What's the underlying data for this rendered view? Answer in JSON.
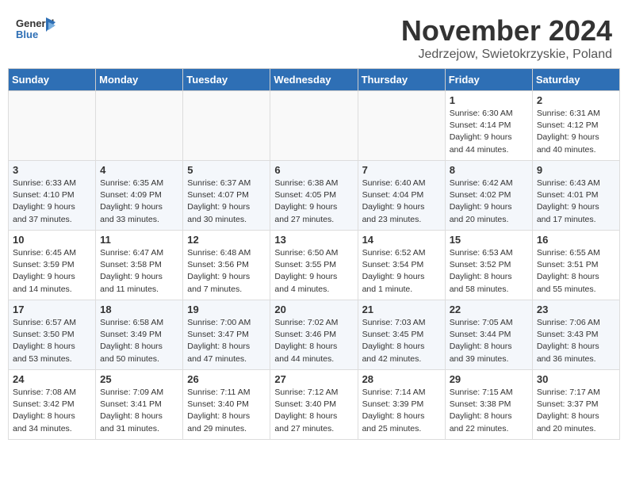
{
  "header": {
    "logo_general": "General",
    "logo_blue": "Blue",
    "month": "November 2024",
    "location": "Jedrzejow, Swietokrzyskie, Poland"
  },
  "weekdays": [
    "Sunday",
    "Monday",
    "Tuesday",
    "Wednesday",
    "Thursday",
    "Friday",
    "Saturday"
  ],
  "weeks": [
    [
      {
        "day": "",
        "info": ""
      },
      {
        "day": "",
        "info": ""
      },
      {
        "day": "",
        "info": ""
      },
      {
        "day": "",
        "info": ""
      },
      {
        "day": "",
        "info": ""
      },
      {
        "day": "1",
        "info": "Sunrise: 6:30 AM\nSunset: 4:14 PM\nDaylight: 9 hours\nand 44 minutes."
      },
      {
        "day": "2",
        "info": "Sunrise: 6:31 AM\nSunset: 4:12 PM\nDaylight: 9 hours\nand 40 minutes."
      }
    ],
    [
      {
        "day": "3",
        "info": "Sunrise: 6:33 AM\nSunset: 4:10 PM\nDaylight: 9 hours\nand 37 minutes."
      },
      {
        "day": "4",
        "info": "Sunrise: 6:35 AM\nSunset: 4:09 PM\nDaylight: 9 hours\nand 33 minutes."
      },
      {
        "day": "5",
        "info": "Sunrise: 6:37 AM\nSunset: 4:07 PM\nDaylight: 9 hours\nand 30 minutes."
      },
      {
        "day": "6",
        "info": "Sunrise: 6:38 AM\nSunset: 4:05 PM\nDaylight: 9 hours\nand 27 minutes."
      },
      {
        "day": "7",
        "info": "Sunrise: 6:40 AM\nSunset: 4:04 PM\nDaylight: 9 hours\nand 23 minutes."
      },
      {
        "day": "8",
        "info": "Sunrise: 6:42 AM\nSunset: 4:02 PM\nDaylight: 9 hours\nand 20 minutes."
      },
      {
        "day": "9",
        "info": "Sunrise: 6:43 AM\nSunset: 4:01 PM\nDaylight: 9 hours\nand 17 minutes."
      }
    ],
    [
      {
        "day": "10",
        "info": "Sunrise: 6:45 AM\nSunset: 3:59 PM\nDaylight: 9 hours\nand 14 minutes."
      },
      {
        "day": "11",
        "info": "Sunrise: 6:47 AM\nSunset: 3:58 PM\nDaylight: 9 hours\nand 11 minutes."
      },
      {
        "day": "12",
        "info": "Sunrise: 6:48 AM\nSunset: 3:56 PM\nDaylight: 9 hours\nand 7 minutes."
      },
      {
        "day": "13",
        "info": "Sunrise: 6:50 AM\nSunset: 3:55 PM\nDaylight: 9 hours\nand 4 minutes."
      },
      {
        "day": "14",
        "info": "Sunrise: 6:52 AM\nSunset: 3:54 PM\nDaylight: 9 hours\nand 1 minute."
      },
      {
        "day": "15",
        "info": "Sunrise: 6:53 AM\nSunset: 3:52 PM\nDaylight: 8 hours\nand 58 minutes."
      },
      {
        "day": "16",
        "info": "Sunrise: 6:55 AM\nSunset: 3:51 PM\nDaylight: 8 hours\nand 55 minutes."
      }
    ],
    [
      {
        "day": "17",
        "info": "Sunrise: 6:57 AM\nSunset: 3:50 PM\nDaylight: 8 hours\nand 53 minutes."
      },
      {
        "day": "18",
        "info": "Sunrise: 6:58 AM\nSunset: 3:49 PM\nDaylight: 8 hours\nand 50 minutes."
      },
      {
        "day": "19",
        "info": "Sunrise: 7:00 AM\nSunset: 3:47 PM\nDaylight: 8 hours\nand 47 minutes."
      },
      {
        "day": "20",
        "info": "Sunrise: 7:02 AM\nSunset: 3:46 PM\nDaylight: 8 hours\nand 44 minutes."
      },
      {
        "day": "21",
        "info": "Sunrise: 7:03 AM\nSunset: 3:45 PM\nDaylight: 8 hours\nand 42 minutes."
      },
      {
        "day": "22",
        "info": "Sunrise: 7:05 AM\nSunset: 3:44 PM\nDaylight: 8 hours\nand 39 minutes."
      },
      {
        "day": "23",
        "info": "Sunrise: 7:06 AM\nSunset: 3:43 PM\nDaylight: 8 hours\nand 36 minutes."
      }
    ],
    [
      {
        "day": "24",
        "info": "Sunrise: 7:08 AM\nSunset: 3:42 PM\nDaylight: 8 hours\nand 34 minutes."
      },
      {
        "day": "25",
        "info": "Sunrise: 7:09 AM\nSunset: 3:41 PM\nDaylight: 8 hours\nand 31 minutes."
      },
      {
        "day": "26",
        "info": "Sunrise: 7:11 AM\nSunset: 3:40 PM\nDaylight: 8 hours\nand 29 minutes."
      },
      {
        "day": "27",
        "info": "Sunrise: 7:12 AM\nSunset: 3:40 PM\nDaylight: 8 hours\nand 27 minutes."
      },
      {
        "day": "28",
        "info": "Sunrise: 7:14 AM\nSunset: 3:39 PM\nDaylight: 8 hours\nand 25 minutes."
      },
      {
        "day": "29",
        "info": "Sunrise: 7:15 AM\nSunset: 3:38 PM\nDaylight: 8 hours\nand 22 minutes."
      },
      {
        "day": "30",
        "info": "Sunrise: 7:17 AM\nSunset: 3:37 PM\nDaylight: 8 hours\nand 20 minutes."
      }
    ]
  ]
}
